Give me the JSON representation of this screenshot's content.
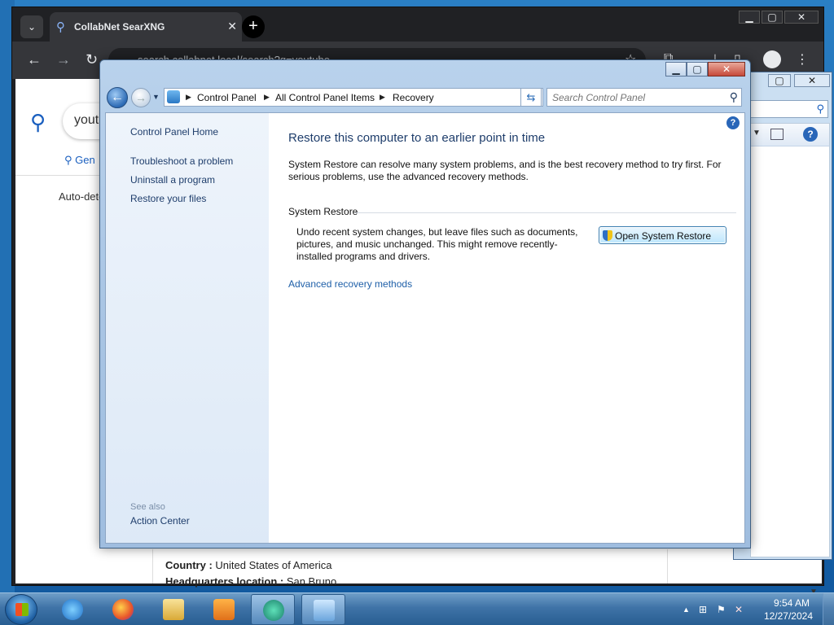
{
  "browser": {
    "tab_title": "CollabNet SearXNG",
    "url": "search.collabnet.local/search?q=youtube",
    "search_query": "youtu",
    "category_tab": "Gen",
    "auto_detect": "Auto-dete",
    "info": [
      {
        "label": "Country : ",
        "value": "United States of America"
      },
      {
        "label": "Headquarters location : ",
        "value": "San Bruno"
      }
    ]
  },
  "control_panel": {
    "breadcrumb": [
      "Control Panel",
      "All Control Panel Items",
      "Recovery"
    ],
    "search_placeholder": "Search Control Panel",
    "sidebar": {
      "home": "Control Panel Home",
      "links": [
        "Troubleshoot a problem",
        "Uninstall a program",
        "Restore your files"
      ],
      "see_also_title": "See also",
      "see_also": [
        "Action Center"
      ]
    },
    "main": {
      "title": "Restore this computer to an earlier point in time",
      "description": "System Restore can resolve many system problems, and is the best recovery method to try first. For serious problems, use the advanced recovery methods.",
      "group_title": "System Restore",
      "group_description": "Undo recent system changes, but leave files such as documents, pictures, and music unchanged. This might remove recently-installed programs and drivers.",
      "button_label": "Open System Restore",
      "advanced_link": "Advanced recovery methods"
    }
  },
  "taskbar": {
    "items": [
      "internet-explorer",
      "firefox",
      "file-explorer",
      "media-player",
      "app-green",
      "control-panel"
    ],
    "clock_time": "9:54 AM",
    "clock_date": "12/27/2024"
  }
}
